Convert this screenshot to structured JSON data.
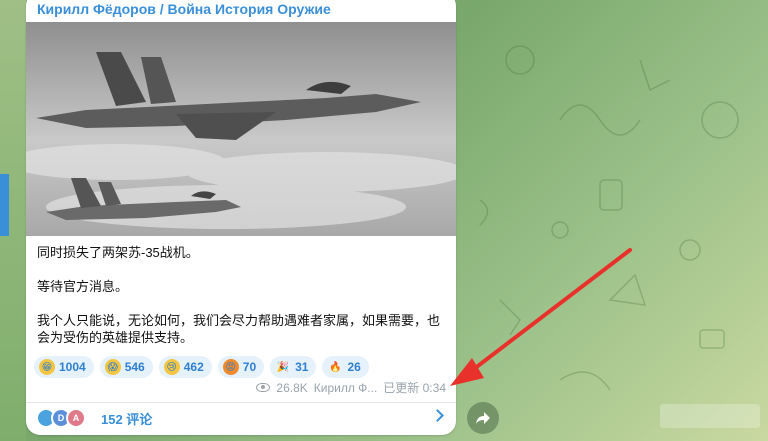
{
  "post": {
    "channel": "Кирилл Фёдоров / Война История Оружие",
    "text": [
      "同时损失了两架苏-35战机。",
      "等待官方消息。",
      "我个人只能说，无论如何，我们会尽力帮助遇难者家属，如果需要，也会为受伤的英雄提供支持。"
    ],
    "reactions": [
      {
        "icon": "grinning-face",
        "count": "1004",
        "color": "#f4c542"
      },
      {
        "icon": "screaming-face",
        "count": "546",
        "color": "#f4c542"
      },
      {
        "icon": "crying-face",
        "count": "462",
        "color": "#f4c542"
      },
      {
        "icon": "angry-face",
        "count": "70",
        "color": "#f08a2c"
      },
      {
        "icon": "party-popper",
        "count": "31",
        "color": "#e8a23a"
      },
      {
        "icon": "fire",
        "count": "26",
        "color": "#f25a2a"
      }
    ],
    "views": "26.8K",
    "author": "Кирилл Ф...",
    "edited": "已更新 0:34",
    "comments": {
      "label": "152 评论",
      "avatars": [
        {
          "letter": "",
          "color": "#4aa3df"
        },
        {
          "letter": "D",
          "color": "#5b8fd9"
        },
        {
          "letter": "A",
          "color": "#e07a8a"
        }
      ]
    }
  },
  "colors": {
    "accent": "#3a8fd9",
    "annotation": "#e8312a"
  }
}
